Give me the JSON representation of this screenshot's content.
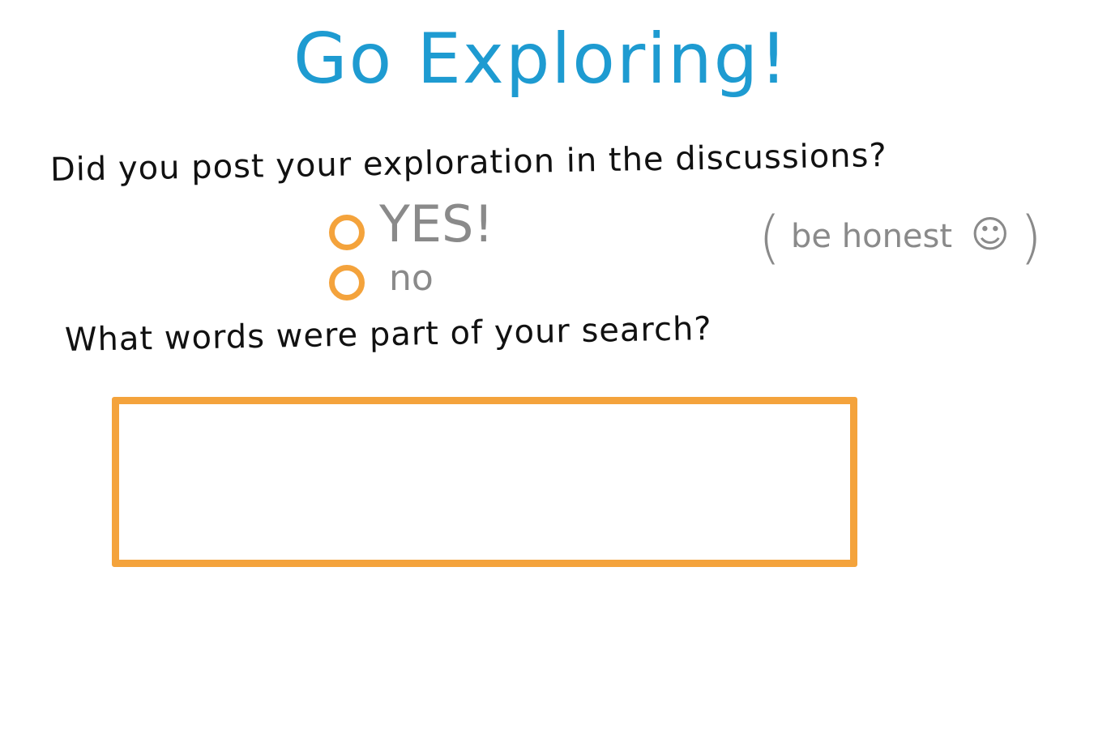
{
  "title": "Go Exploring!",
  "question1": {
    "text": "Did you post your exploration in the discussions?",
    "options": [
      {
        "label": "YES!",
        "selected": false
      },
      {
        "label": "no",
        "selected": false
      }
    ],
    "hint": "be honest",
    "hint_open": "(",
    "hint_close": ")",
    "hint_icon": "smiley-icon"
  },
  "question2": {
    "text": "What words were part of your search?",
    "answer_value": ""
  },
  "colors": {
    "title": "#1e9bd1",
    "accent": "#f4a33c",
    "muted_text": "#8a8a8a",
    "text": "#111111"
  }
}
